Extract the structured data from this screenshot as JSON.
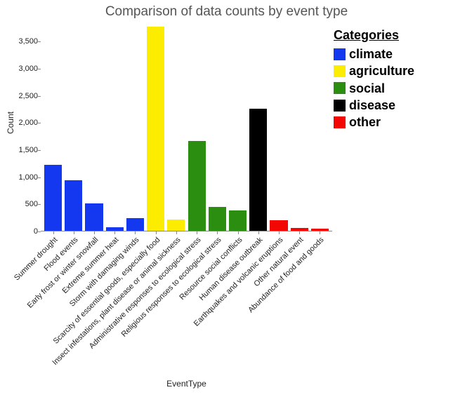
{
  "chart_data": {
    "type": "bar",
    "title": "Comparison of data counts by event type",
    "xlabel": "EventType",
    "ylabel": "Count",
    "ylim": [
      0,
      3750
    ],
    "y_ticks": [
      0,
      500,
      1000,
      1500,
      2000,
      2500,
      3000,
      3500
    ],
    "y_tick_labels": [
      "0",
      "500",
      "1,000",
      "1,500",
      "2,000",
      "2,500",
      "3,000",
      "3,500"
    ],
    "legend_title": "Categories",
    "legend": [
      {
        "name": "climate",
        "color": "#1338F0"
      },
      {
        "name": "agriculture",
        "color": "#FBEC00"
      },
      {
        "name": "social",
        "color": "#2B8E11"
      },
      {
        "name": "disease",
        "color": "#000000"
      },
      {
        "name": "other",
        "color": "#F30703"
      }
    ],
    "bars": [
      {
        "label": "Summer drought",
        "value": 1210,
        "category": "climate"
      },
      {
        "label": "Flood events",
        "value": 930,
        "category": "climate"
      },
      {
        "label": "Early frost or winter snowfall",
        "value": 510,
        "category": "climate"
      },
      {
        "label": "Extreme summer heat",
        "value": 60,
        "category": "climate"
      },
      {
        "label": "Storm with damaging winds",
        "value": 230,
        "category": "climate"
      },
      {
        "label": "Scarcity of essential goods, especially food",
        "value": 3760,
        "category": "agriculture"
      },
      {
        "label": "Insect infestations, plant disease or animal sickness",
        "value": 210,
        "category": "agriculture"
      },
      {
        "label": "Administrative responses to ecological stress",
        "value": 1660,
        "category": "social"
      },
      {
        "label": "Religious responses to ecological stress",
        "value": 440,
        "category": "social"
      },
      {
        "label": "Resource social conflicts",
        "value": 380,
        "category": "social"
      },
      {
        "label": "Human disease outbreak",
        "value": 2250,
        "category": "disease"
      },
      {
        "label": "Earthquakes and volcanic eruptions",
        "value": 200,
        "category": "other"
      },
      {
        "label": "Other natural event",
        "value": 50,
        "category": "other"
      },
      {
        "label": "Abundance of food and goods",
        "value": 40,
        "category": "other"
      }
    ]
  }
}
